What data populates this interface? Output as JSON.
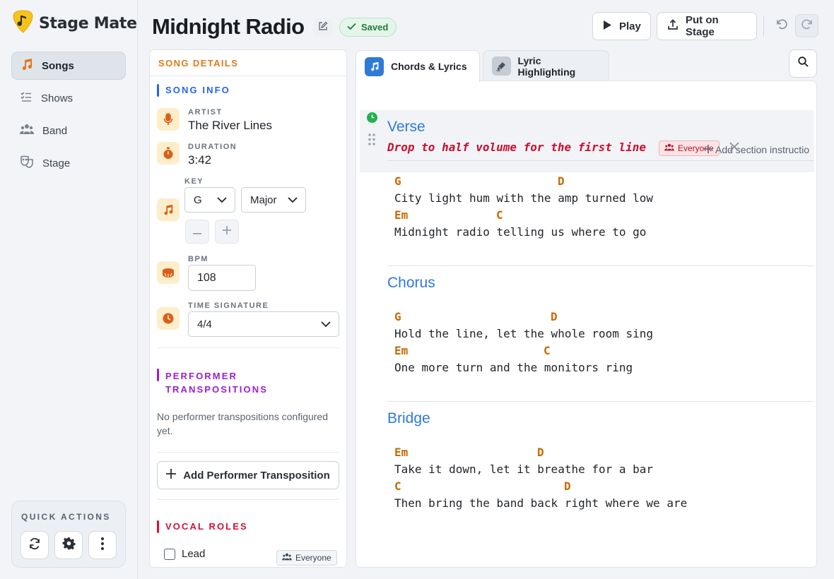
{
  "app": {
    "name": "Stage Mate"
  },
  "nav": {
    "items": [
      {
        "label": "Songs",
        "active": true
      },
      {
        "label": "Shows"
      },
      {
        "label": "Band"
      },
      {
        "label": "Stage"
      }
    ]
  },
  "quick_actions": {
    "title": "QUICK ACTIONS"
  },
  "header": {
    "title": "Midnight Radio",
    "saved": "Saved",
    "play": "Play",
    "put_on_stage": "Put on Stage"
  },
  "details": {
    "panel_title": "SONG DETAILS",
    "info_title": "SONG INFO",
    "artist_label": "ARTIST",
    "artist": "The River Lines",
    "duration_label": "DURATION",
    "duration": "3:42",
    "key_label": "KEY",
    "key": "G",
    "mode": "Major",
    "bpm_label": "BPM",
    "bpm": "108",
    "time_sig_label": "TIME SIGNATURE",
    "time_sig": "4/4",
    "transpositions_title": "PERFORMER TRANSPOSITIONS",
    "transpositions_empty": "No performer transpositions configured yet.",
    "add_transposition": "Add Performer Transposition",
    "vocal_roles_title": "VOCAL ROLES",
    "vocal_roles": [
      {
        "label": "Lead",
        "audience": "Everyone",
        "checked": false
      }
    ]
  },
  "tabs": [
    {
      "label": "Chords & Lyrics",
      "active": true
    },
    {
      "label": "Lyric Highlighting"
    }
  ],
  "sheet": {
    "sections": [
      {
        "name": "Verse",
        "instruction": "Drop to half volume for the first line",
        "instruction_audience": "Everyone",
        "add_instruction": "Add section instructio",
        "lines": [
          {
            "chords": [
              {
                "c": "G",
                "col": 0
              },
              {
                "c": "D",
                "col": 24
              }
            ],
            "lyric": "City light hum with the amp turned low"
          },
          {
            "chords": [
              {
                "c": "Em",
                "col": 0
              },
              {
                "c": "C",
                "col": 15
              }
            ],
            "lyric": "Midnight radio telling us where to go"
          }
        ]
      },
      {
        "name": "Chorus",
        "lines": [
          {
            "chords": [
              {
                "c": "G",
                "col": 0
              },
              {
                "c": "D",
                "col": 23
              }
            ],
            "lyric": "Hold the line, let the whole room sing"
          },
          {
            "chords": [
              {
                "c": "Em",
                "col": 0
              },
              {
                "c": "C",
                "col": 22
              }
            ],
            "lyric": "One more turn and the monitors ring"
          }
        ]
      },
      {
        "name": "Bridge",
        "lines": [
          {
            "chords": [
              {
                "c": "Em",
                "col": 0
              },
              {
                "c": "D",
                "col": 21
              }
            ],
            "lyric": "Take it down, let it breathe for a bar"
          },
          {
            "chords": [
              {
                "c": "C",
                "col": 0
              },
              {
                "c": "D",
                "col": 25
              }
            ],
            "lyric": "Then bring the band back right where we are"
          }
        ]
      }
    ]
  },
  "colors": {
    "accent_orange": "#e07a1a",
    "section_blue": "#2f7ad8",
    "chord_orange": "#c66a00",
    "instruction_red": "#c8102e",
    "info_blue": "#2563eb",
    "transpositions_purple": "#9b1fd1",
    "vocal_red": "#d0123b"
  }
}
